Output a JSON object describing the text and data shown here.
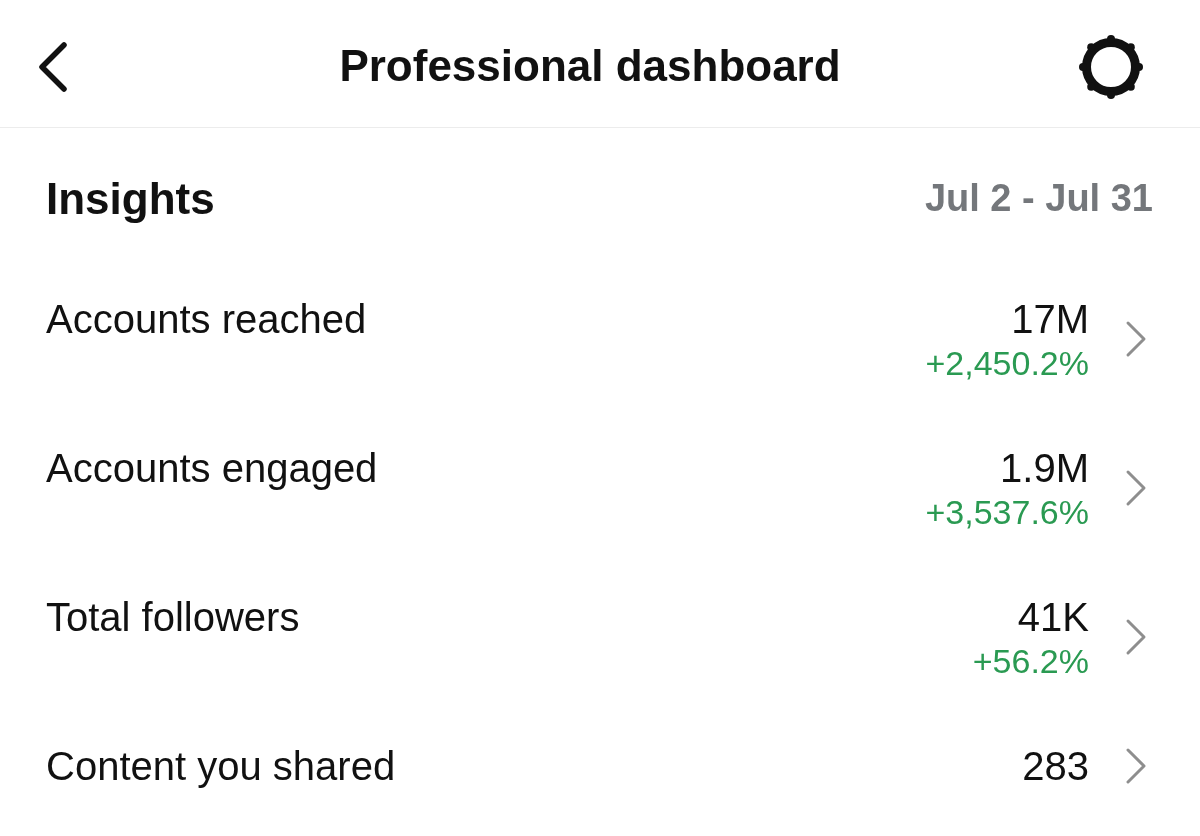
{
  "header": {
    "title": "Professional dashboard"
  },
  "insights": {
    "title": "Insights",
    "date_range": "Jul 2 - Jul 31",
    "metrics": [
      {
        "label": "Accounts reached",
        "value": "17M",
        "change": "+2,450.2%"
      },
      {
        "label": "Accounts engaged",
        "value": "1.9M",
        "change": "+3,537.6%"
      },
      {
        "label": "Total followers",
        "value": "41K",
        "change": "+56.2%"
      },
      {
        "label": "Content you shared",
        "value": "283"
      }
    ]
  }
}
